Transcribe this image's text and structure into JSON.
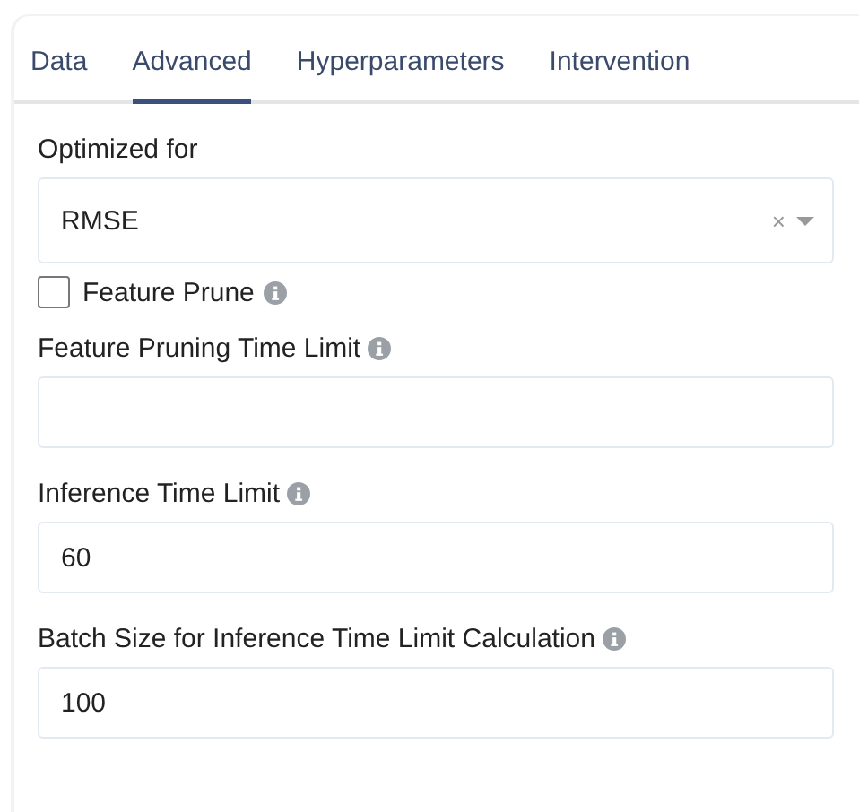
{
  "tabs": [
    {
      "label": "Data",
      "selected": false
    },
    {
      "label": "Advanced",
      "selected": true
    },
    {
      "label": "Hyperparameters",
      "selected": false
    },
    {
      "label": "Intervention",
      "selected": false
    }
  ],
  "fields": [
    {
      "kind": "select",
      "label": "Optimized for",
      "value": "RMSE",
      "clear": "×"
    },
    {
      "kind": "checkbox",
      "label": "Feature Prune",
      "checked": false,
      "info": true
    },
    {
      "kind": "text",
      "label": "Feature Pruning Time Limit",
      "info": true
    },
    {
      "kind": "text",
      "label": "Inference Time Limit",
      "value": "60",
      "info": true
    },
    {
      "kind": "text",
      "label": "Batch Size for Inference Time Limit Calculation",
      "value": "100",
      "info": true
    }
  ]
}
